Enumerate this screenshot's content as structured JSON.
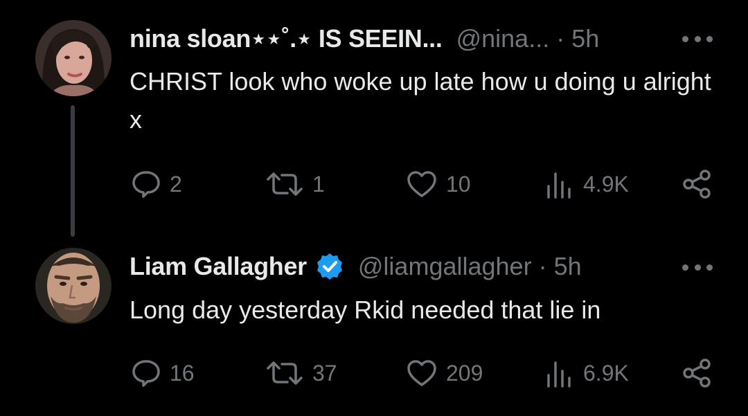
{
  "tweets": [
    {
      "display_name": "nina sloan⋆⋆˚.⋆ IS SEEIN...",
      "handle": "@nina...",
      "separator": "·",
      "time": "5h",
      "text": "CHRIST look who woke up late how u doing u alright x",
      "verified": false,
      "stats": {
        "replies": "2",
        "retweets": "1",
        "likes": "10",
        "views": "4.9K"
      }
    },
    {
      "display_name": "Liam Gallagher",
      "handle": "@liamgallagher",
      "separator": "·",
      "time": "5h",
      "text": "Long day yesterday Rkid needed that lie in",
      "verified": true,
      "stats": {
        "replies": "16",
        "retweets": "37",
        "likes": "209",
        "views": "6.9K"
      }
    }
  ],
  "colors": {
    "background": "#000000",
    "text": "#e7e9ea",
    "muted": "#71767b",
    "verified": "#1d9bf0",
    "thread_line": "#3b3d40"
  },
  "icons": [
    "reply-icon",
    "retweet-icon",
    "like-icon",
    "views-icon",
    "share-icon",
    "more-icon",
    "verified-badge-icon"
  ]
}
